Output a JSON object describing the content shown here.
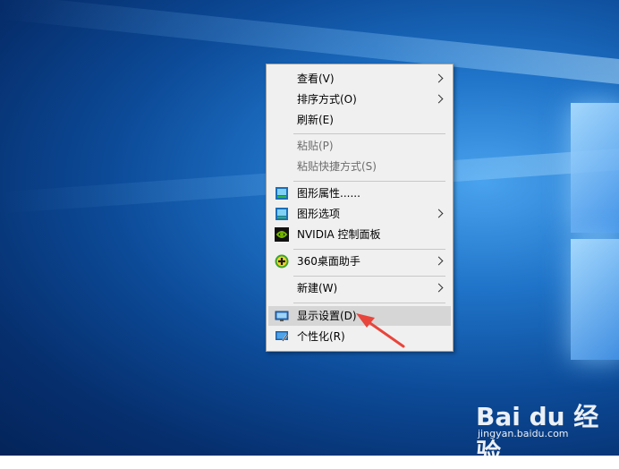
{
  "context_menu": {
    "items": [
      {
        "label": "查看(V)",
        "has_submenu": true,
        "enabled": true
      },
      {
        "label": "排序方式(O)",
        "has_submenu": true,
        "enabled": true
      },
      {
        "label": "刷新(E)",
        "has_submenu": false,
        "enabled": true
      },
      {
        "label": "粘贴(P)",
        "has_submenu": false,
        "enabled": false
      },
      {
        "label": "粘贴快捷方式(S)",
        "has_submenu": false,
        "enabled": false
      },
      {
        "label": "图形属性......",
        "has_submenu": false,
        "enabled": true,
        "icon": "intel-graphics-icon"
      },
      {
        "label": "图形选项",
        "has_submenu": true,
        "enabled": true,
        "icon": "intel-graphics-icon"
      },
      {
        "label": "NVIDIA 控制面板",
        "has_submenu": false,
        "enabled": true,
        "icon": "nvidia-icon"
      },
      {
        "label": "360桌面助手",
        "has_submenu": true,
        "enabled": true,
        "icon": "360-icon"
      },
      {
        "label": "新建(W)",
        "has_submenu": true,
        "enabled": true
      },
      {
        "label": "显示设置(D)",
        "has_submenu": false,
        "enabled": true,
        "icon": "display-settings-icon",
        "highlighted": true
      },
      {
        "label": "个性化(R)",
        "has_submenu": false,
        "enabled": true,
        "icon": "personalize-icon"
      }
    ]
  },
  "watermark": {
    "brand": "Bai du 经验",
    "url": "jingyan.baidu.com"
  },
  "colors": {
    "menu_bg": "#f0f0f0",
    "highlight": "#d6d6d6",
    "annotation_arrow": "#e8453c",
    "desktop_blue": "#0c4a97"
  }
}
